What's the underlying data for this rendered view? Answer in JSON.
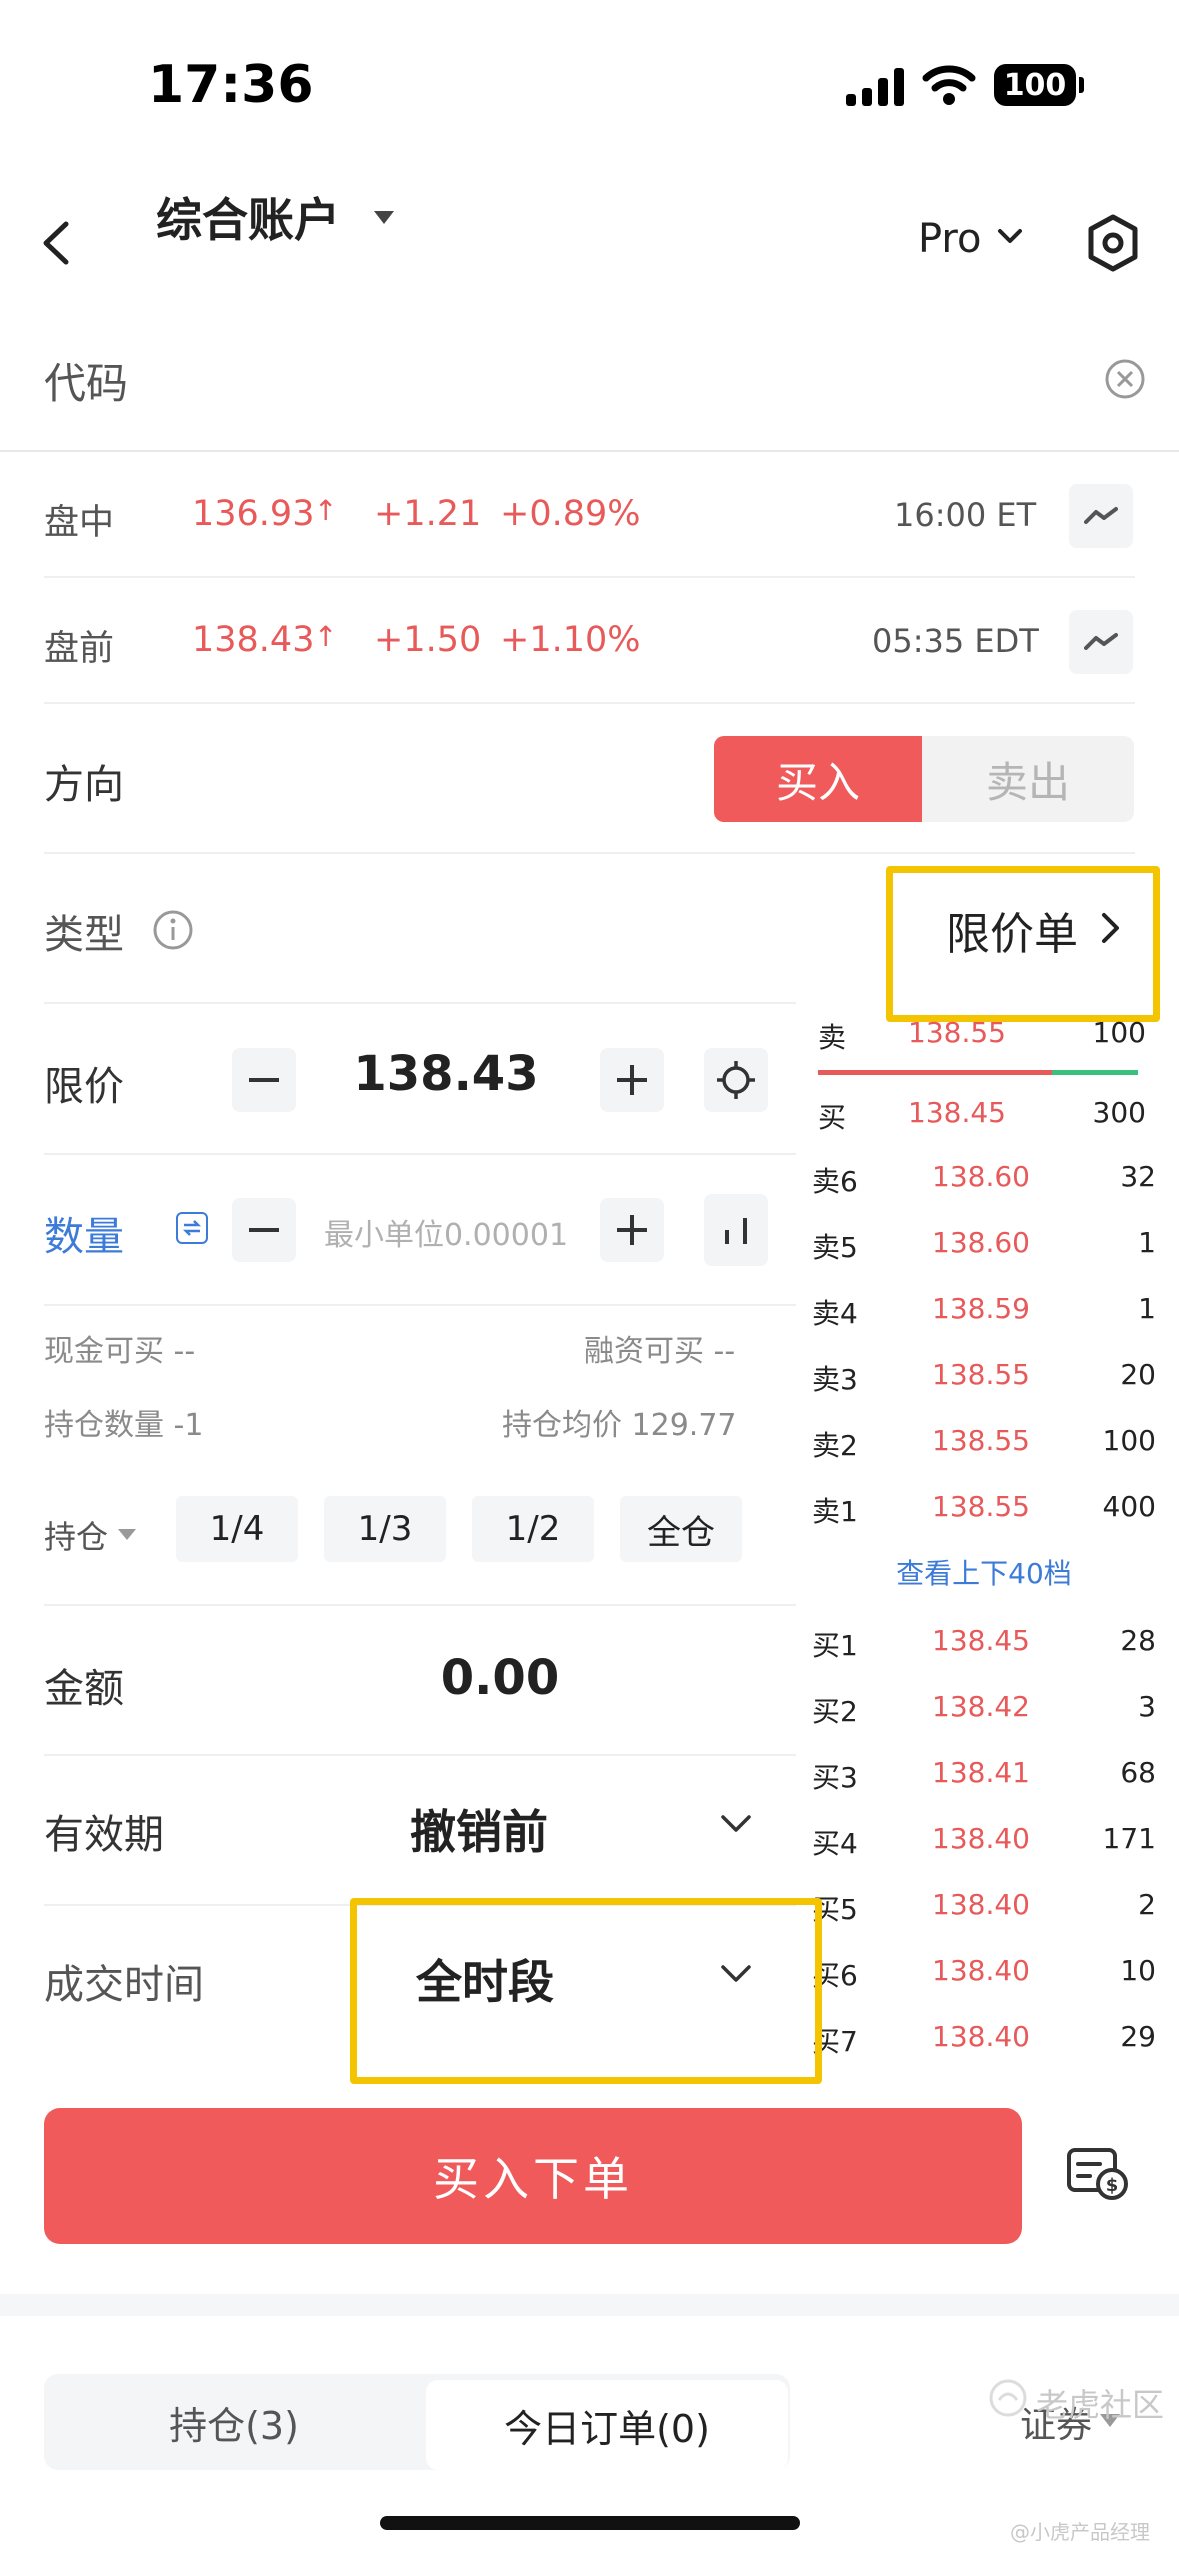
{
  "status_bar": {
    "time": "17:36",
    "battery": "100"
  },
  "header": {
    "account": "综合账户",
    "pro_label": "Pro"
  },
  "code_field": {
    "placeholder": "代码"
  },
  "quotes": [
    {
      "session": "盘中",
      "price": "136.93",
      "arrow": "↑",
      "change": "+1.21",
      "pct": "+0.89%",
      "time": "16:00 ET"
    },
    {
      "session": "盘前",
      "price": "138.43",
      "arrow": "↑",
      "change": "+1.50",
      "pct": "+1.10%",
      "time": "05:35 EDT"
    }
  ],
  "direction": {
    "label": "方向",
    "buy": "买入",
    "sell": "卖出"
  },
  "order_type": {
    "label": "类型",
    "value": "限价单"
  },
  "limit_price": {
    "label": "限价",
    "value": "138.43"
  },
  "quantity": {
    "label": "数量",
    "placeholder": "最小单位0.00001"
  },
  "info": {
    "cash_buy": "现金可买 --",
    "margin_buy": "融资可买 --",
    "position_qty": "持仓数量 -1",
    "avg_cost": "持仓均价 129.77"
  },
  "position_select": {
    "label": "持仓",
    "fractions": [
      "1/4",
      "1/3",
      "1/2",
      "全仓"
    ]
  },
  "amount": {
    "label": "金额",
    "value": "0.00"
  },
  "validity": {
    "label": "有效期",
    "value": "撤销前"
  },
  "trade_time": {
    "label": "成交时间",
    "value": "全时段"
  },
  "order_book": {
    "top_ask": {
      "label": "卖",
      "price": "138.55",
      "qty": "100"
    },
    "top_bid": {
      "label": "买",
      "price": "138.45",
      "qty": "300"
    },
    "ask_bid_ratio": 0.73,
    "asks": [
      {
        "label": "卖6",
        "price": "138.60",
        "qty": "32"
      },
      {
        "label": "卖5",
        "price": "138.60",
        "qty": "1"
      },
      {
        "label": "卖4",
        "price": "138.59",
        "qty": "1"
      },
      {
        "label": "卖3",
        "price": "138.55",
        "qty": "20"
      },
      {
        "label": "卖2",
        "price": "138.55",
        "qty": "100"
      },
      {
        "label": "卖1",
        "price": "138.55",
        "qty": "400"
      }
    ],
    "view_more": "查看上下40档",
    "bids": [
      {
        "label": "买1",
        "price": "138.45",
        "qty": "28"
      },
      {
        "label": "买2",
        "price": "138.42",
        "qty": "3"
      },
      {
        "label": "买3",
        "price": "138.41",
        "qty": "68"
      },
      {
        "label": "买4",
        "price": "138.40",
        "qty": "171"
      },
      {
        "label": "买5",
        "price": "138.40",
        "qty": "2"
      },
      {
        "label": "买6",
        "price": "138.40",
        "qty": "10"
      },
      {
        "label": "买7",
        "price": "138.40",
        "qty": "29"
      }
    ]
  },
  "submit": {
    "label": "买入下单"
  },
  "bottom_tabs": {
    "positions": "持仓(3)",
    "orders": "今日订单(0)",
    "filter": "证券"
  },
  "watermark": {
    "line1": "老虎社区",
    "line2": "@小虎产品经理"
  },
  "colors": {
    "accent_red": "#f05a5a",
    "highlight_yellow": "#f5c400",
    "link_blue": "#3d7bd9"
  }
}
